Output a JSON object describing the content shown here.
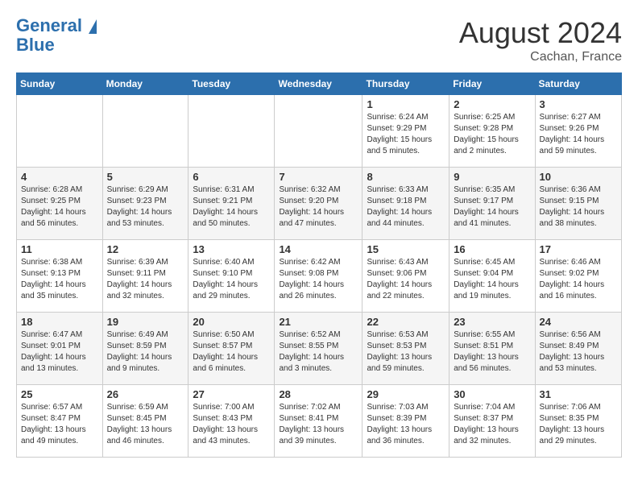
{
  "header": {
    "logo_line1": "General",
    "logo_line2": "Blue",
    "month": "August 2024",
    "location": "Cachan, France"
  },
  "days_of_week": [
    "Sunday",
    "Monday",
    "Tuesday",
    "Wednesday",
    "Thursday",
    "Friday",
    "Saturday"
  ],
  "weeks": [
    [
      {
        "day": "",
        "info": ""
      },
      {
        "day": "",
        "info": ""
      },
      {
        "day": "",
        "info": ""
      },
      {
        "day": "",
        "info": ""
      },
      {
        "day": "1",
        "info": "Sunrise: 6:24 AM\nSunset: 9:29 PM\nDaylight: 15 hours\nand 5 minutes."
      },
      {
        "day": "2",
        "info": "Sunrise: 6:25 AM\nSunset: 9:28 PM\nDaylight: 15 hours\nand 2 minutes."
      },
      {
        "day": "3",
        "info": "Sunrise: 6:27 AM\nSunset: 9:26 PM\nDaylight: 14 hours\nand 59 minutes."
      }
    ],
    [
      {
        "day": "4",
        "info": "Sunrise: 6:28 AM\nSunset: 9:25 PM\nDaylight: 14 hours\nand 56 minutes."
      },
      {
        "day": "5",
        "info": "Sunrise: 6:29 AM\nSunset: 9:23 PM\nDaylight: 14 hours\nand 53 minutes."
      },
      {
        "day": "6",
        "info": "Sunrise: 6:31 AM\nSunset: 9:21 PM\nDaylight: 14 hours\nand 50 minutes."
      },
      {
        "day": "7",
        "info": "Sunrise: 6:32 AM\nSunset: 9:20 PM\nDaylight: 14 hours\nand 47 minutes."
      },
      {
        "day": "8",
        "info": "Sunrise: 6:33 AM\nSunset: 9:18 PM\nDaylight: 14 hours\nand 44 minutes."
      },
      {
        "day": "9",
        "info": "Sunrise: 6:35 AM\nSunset: 9:17 PM\nDaylight: 14 hours\nand 41 minutes."
      },
      {
        "day": "10",
        "info": "Sunrise: 6:36 AM\nSunset: 9:15 PM\nDaylight: 14 hours\nand 38 minutes."
      }
    ],
    [
      {
        "day": "11",
        "info": "Sunrise: 6:38 AM\nSunset: 9:13 PM\nDaylight: 14 hours\nand 35 minutes."
      },
      {
        "day": "12",
        "info": "Sunrise: 6:39 AM\nSunset: 9:11 PM\nDaylight: 14 hours\nand 32 minutes."
      },
      {
        "day": "13",
        "info": "Sunrise: 6:40 AM\nSunset: 9:10 PM\nDaylight: 14 hours\nand 29 minutes."
      },
      {
        "day": "14",
        "info": "Sunrise: 6:42 AM\nSunset: 9:08 PM\nDaylight: 14 hours\nand 26 minutes."
      },
      {
        "day": "15",
        "info": "Sunrise: 6:43 AM\nSunset: 9:06 PM\nDaylight: 14 hours\nand 22 minutes."
      },
      {
        "day": "16",
        "info": "Sunrise: 6:45 AM\nSunset: 9:04 PM\nDaylight: 14 hours\nand 19 minutes."
      },
      {
        "day": "17",
        "info": "Sunrise: 6:46 AM\nSunset: 9:02 PM\nDaylight: 14 hours\nand 16 minutes."
      }
    ],
    [
      {
        "day": "18",
        "info": "Sunrise: 6:47 AM\nSunset: 9:01 PM\nDaylight: 14 hours\nand 13 minutes."
      },
      {
        "day": "19",
        "info": "Sunrise: 6:49 AM\nSunset: 8:59 PM\nDaylight: 14 hours\nand 9 minutes."
      },
      {
        "day": "20",
        "info": "Sunrise: 6:50 AM\nSunset: 8:57 PM\nDaylight: 14 hours\nand 6 minutes."
      },
      {
        "day": "21",
        "info": "Sunrise: 6:52 AM\nSunset: 8:55 PM\nDaylight: 14 hours\nand 3 minutes."
      },
      {
        "day": "22",
        "info": "Sunrise: 6:53 AM\nSunset: 8:53 PM\nDaylight: 13 hours\nand 59 minutes."
      },
      {
        "day": "23",
        "info": "Sunrise: 6:55 AM\nSunset: 8:51 PM\nDaylight: 13 hours\nand 56 minutes."
      },
      {
        "day": "24",
        "info": "Sunrise: 6:56 AM\nSunset: 8:49 PM\nDaylight: 13 hours\nand 53 minutes."
      }
    ],
    [
      {
        "day": "25",
        "info": "Sunrise: 6:57 AM\nSunset: 8:47 PM\nDaylight: 13 hours\nand 49 minutes."
      },
      {
        "day": "26",
        "info": "Sunrise: 6:59 AM\nSunset: 8:45 PM\nDaylight: 13 hours\nand 46 minutes."
      },
      {
        "day": "27",
        "info": "Sunrise: 7:00 AM\nSunset: 8:43 PM\nDaylight: 13 hours\nand 43 minutes."
      },
      {
        "day": "28",
        "info": "Sunrise: 7:02 AM\nSunset: 8:41 PM\nDaylight: 13 hours\nand 39 minutes."
      },
      {
        "day": "29",
        "info": "Sunrise: 7:03 AM\nSunset: 8:39 PM\nDaylight: 13 hours\nand 36 minutes."
      },
      {
        "day": "30",
        "info": "Sunrise: 7:04 AM\nSunset: 8:37 PM\nDaylight: 13 hours\nand 32 minutes."
      },
      {
        "day": "31",
        "info": "Sunrise: 7:06 AM\nSunset: 8:35 PM\nDaylight: 13 hours\nand 29 minutes."
      }
    ]
  ]
}
